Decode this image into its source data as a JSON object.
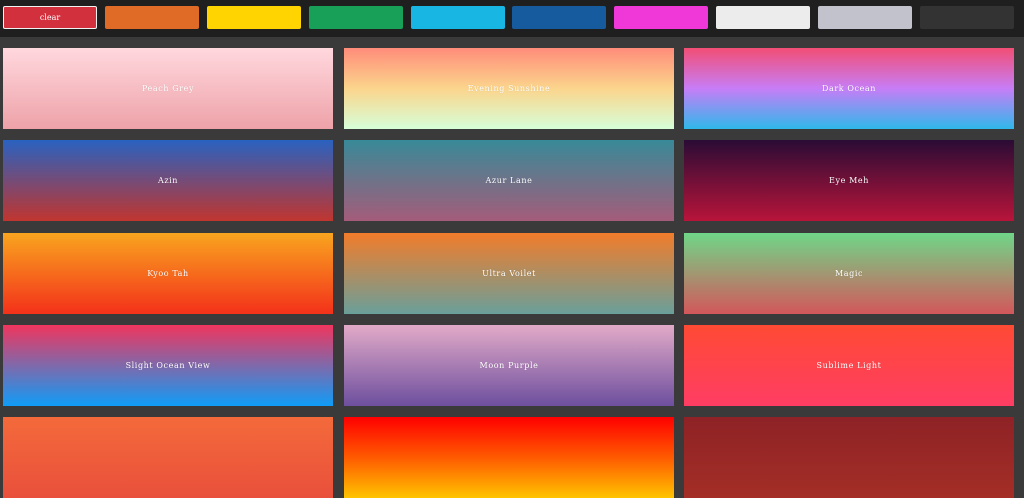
{
  "toolbar": {
    "swatches": [
      {
        "label": "clear",
        "color": "#d3303d",
        "active": true
      },
      {
        "label": "",
        "color": "#df6b26"
      },
      {
        "label": "",
        "color": "#ffd400"
      },
      {
        "label": "",
        "color": "#18a058"
      },
      {
        "label": "",
        "color": "#18b6e3"
      },
      {
        "label": "",
        "color": "#155b9e"
      },
      {
        "label": "",
        "color": "#f038d8"
      },
      {
        "label": "",
        "color": "#ececec"
      },
      {
        "label": "",
        "color": "#c2c2cc"
      },
      {
        "label": "",
        "color": "#333333"
      }
    ]
  },
  "gradients": [
    {
      "name": "Peach Grey",
      "from": "#ffd8de",
      "to": "#eda2a8"
    },
    {
      "name": "Evening Sunshine",
      "from": "#ff8c7a",
      "via": "#fbd58c",
      "to": "#d6ffd8"
    },
    {
      "name": "Dark Ocean",
      "from": "#f24e74",
      "via": "#c77df7",
      "to": "#2fb8ea"
    },
    {
      "name": "Azin",
      "from": "#2962c0",
      "to": "#c0352f"
    },
    {
      "name": "Azur Lane",
      "from": "#388a98",
      "to": "#a45c7a"
    },
    {
      "name": "Eye Meh",
      "from": "#2a0c35",
      "to": "#b8143a"
    },
    {
      "name": "Kyoo Tah",
      "from": "#f9a51f",
      "to": "#f3311a"
    },
    {
      "name": "Ultra Voilet",
      "from": "#f27c2a",
      "to": "#6a9f9a"
    },
    {
      "name": "Magic",
      "from": "#6fd788",
      "to": "#d3575b"
    },
    {
      "name": "Slight Ocean View",
      "from": "#f0355d",
      "to": "#0f9cf7"
    },
    {
      "name": "Moon Purple",
      "from": "#e2aac8",
      "to": "#6d4f9e"
    },
    {
      "name": "Sublime Light",
      "from": "#ff4a34",
      "to": "#ff3d64"
    },
    {
      "name": "",
      "from": "#f46a3b",
      "to": "#e9503b"
    },
    {
      "name": "",
      "from": "#ff0000",
      "via": "#ff5a00",
      "to": "#ffc400"
    },
    {
      "name": "",
      "from": "#8e2226",
      "to": "#a42e26"
    }
  ]
}
